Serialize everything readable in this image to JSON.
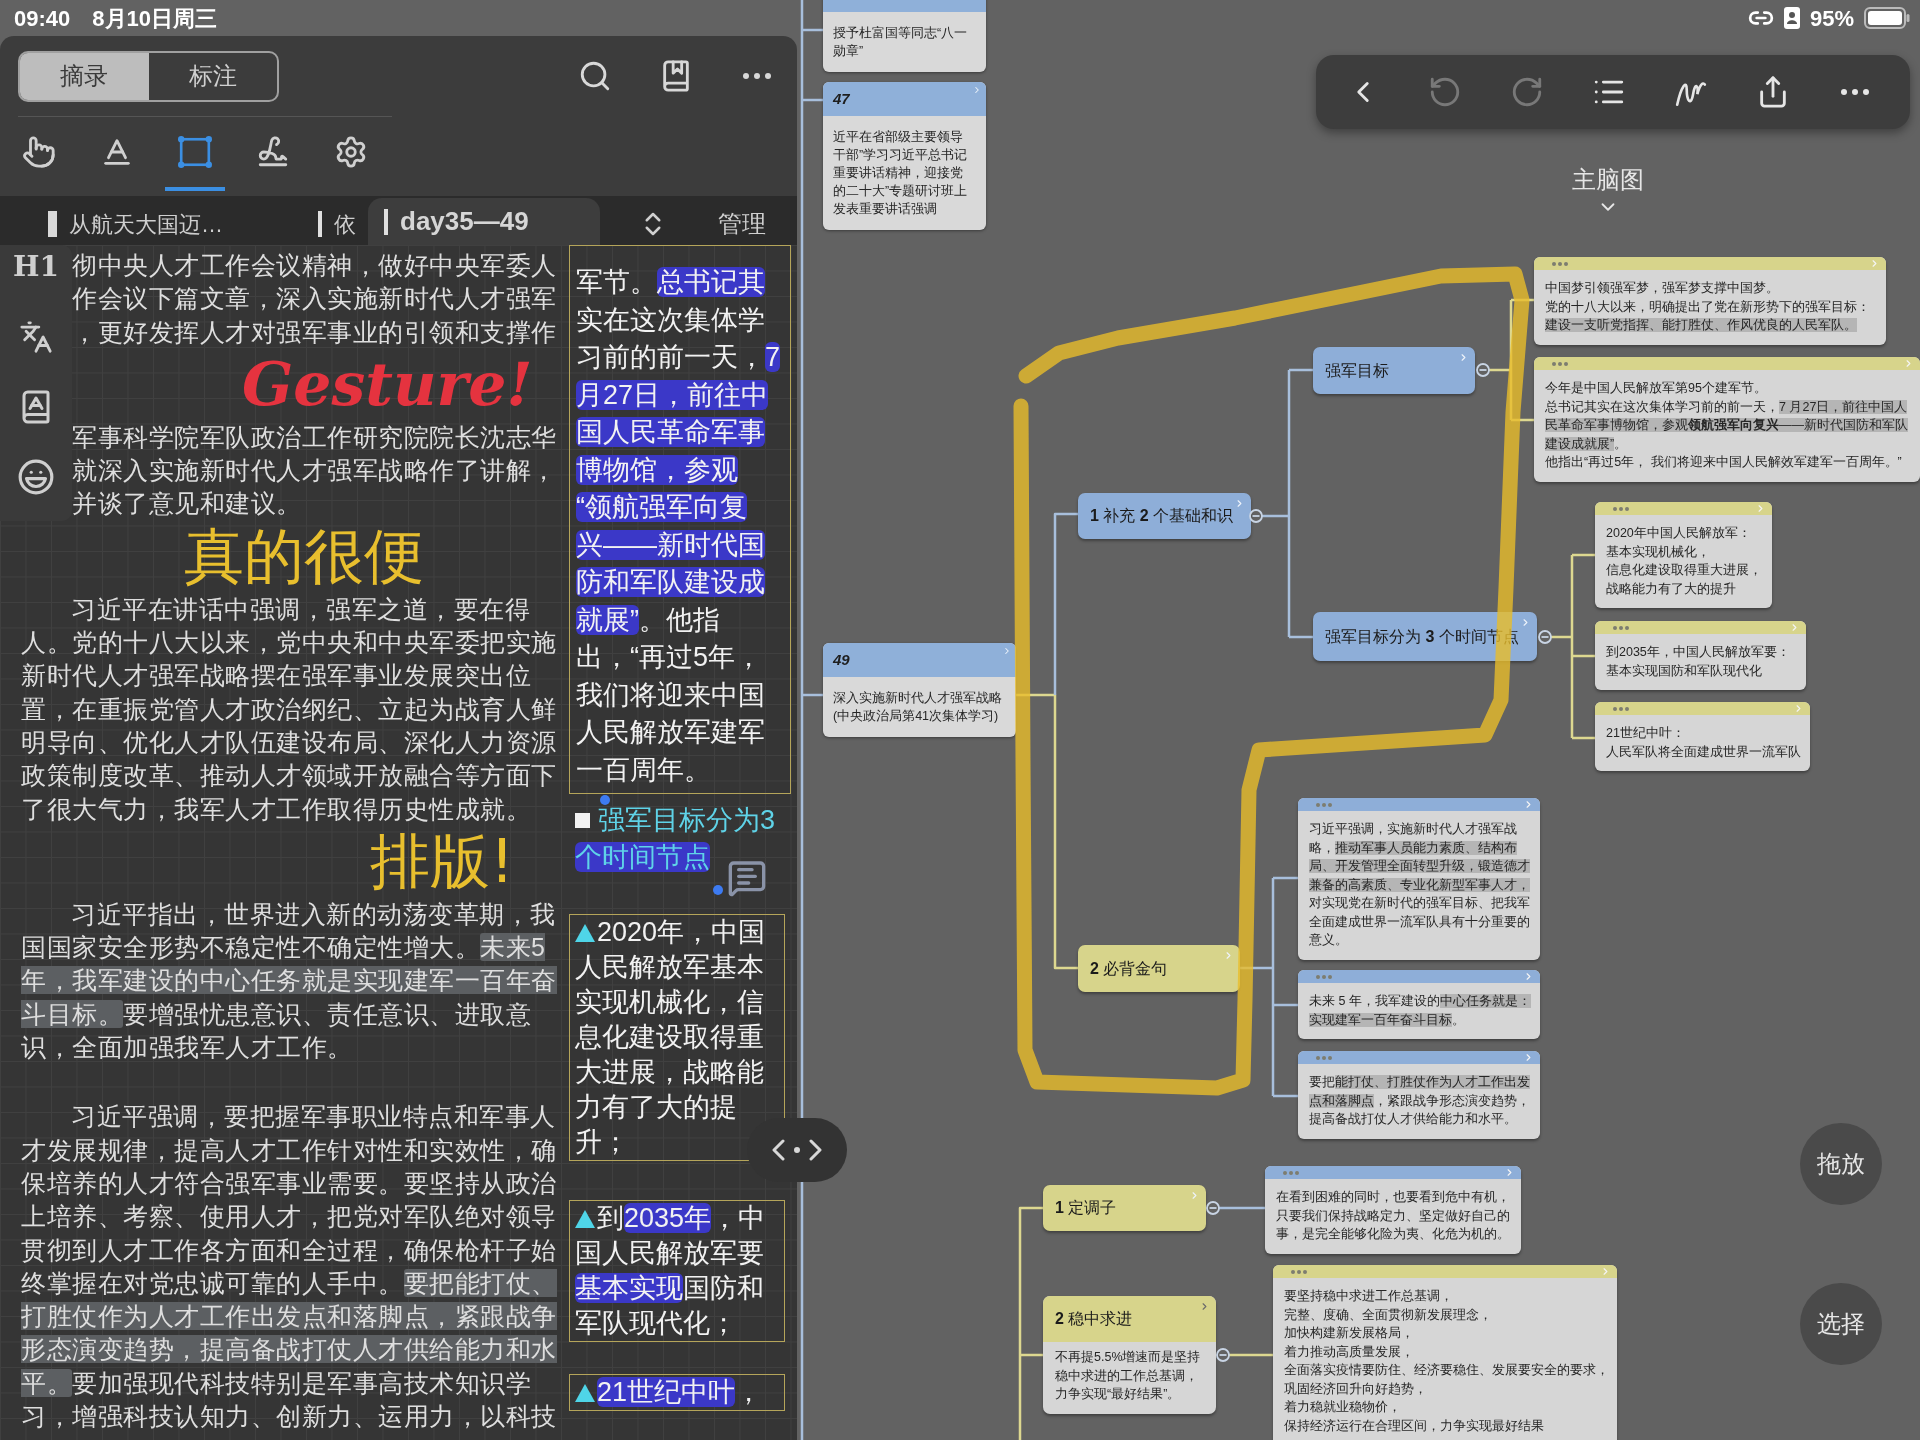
{
  "status_bar": {
    "time": "09:40",
    "date": "8月10日周三",
    "battery": "95%"
  },
  "excerpt_panel": {
    "mode_tabs": [
      {
        "label": "摘录",
        "selected": true
      },
      {
        "label": "标注",
        "selected": false
      }
    ],
    "tools": [
      {
        "selected": false
      },
      {
        "selected": false
      },
      {
        "selected": true
      },
      {
        "selected": false
      },
      {
        "selected": false
      }
    ],
    "doc_tabs": [
      {
        "label": "从航天大国迈…",
        "selected": false
      },
      {
        "label": "依",
        "selected": false
      },
      {
        "label": "day35—49",
        "selected": true
      }
    ],
    "manage_button": "管理",
    "side_toolbar": {
      "heading_button": "H1"
    },
    "paragraphs": [
      {
        "indented": false,
        "segments": [
          {
            "text": "彻中央人才工作会议精神，做好中央军委人作会议下篇文章，深入实施新时代人才强军，更好发挥人才对强军事业的引领和支撑作",
            "highlighted": false
          }
        ]
      },
      {
        "indented": false,
        "segments": [
          {
            "text": "军事科学院军队政治工作研究院院长沈志华就深入实施新时代人才强军战略作了讲解，并谈了意见和建议。",
            "highlighted": false
          }
        ]
      },
      {
        "indented": true,
        "segments": [
          {
            "text": "习近平在讲话中强调，强军之道，要在得人。党的十八大以来，党中央和中央军委把实施新时代人才强军战略摆在强军事业发展突出位置，在重振党管人才政治纲纪、立起为战育人鲜明导向、优化人才队伍建设布局、深化人力资源政策制度改革、推动人才领域开放融合等方面下了很大气力，我军人才工作取得历史性成就。",
            "highlighted": false
          }
        ]
      },
      {
        "indented": true,
        "segments": [
          {
            "text": "习近平指出，世界进入新的动荡变革期，我国国家安全形势不稳定性不确定性增大。",
            "highlighted": false
          },
          {
            "text": "未来5年，我军建设的中心任务就是实现建军一百年奋斗目标。",
            "highlighted": true
          },
          {
            "text": "要增强忧患意识、责任意识、进取意识，全面加强我军人才工作。",
            "highlighted": false
          }
        ]
      },
      {
        "indented": true,
        "segments": [
          {
            "text": "习近平强调，要把握军事职业特点和军事人才发展规律，提高人才工作针对性和实效性，确保培养的人才符合强军事业需要。要坚持从政治上培养、考察、使用人才，把党对军队绝对领导贯彻到人才工作各方面和全过程，确保枪杆子始终掌握在对党忠诚可靠的人手中。",
            "highlighted": false
          },
          {
            "text": "要把能打仗、打胜仗作为人才工作出发点和落脚点，紧跟战争形态演变趋势，提高备战打仗人才供给能力和水平。",
            "highlighted": true
          },
          {
            "text": "要加强现代科技特别是军事高技术知识学习，增强科技认知力、创新力、运用力，以科技",
            "highlighted": false
          }
        ]
      }
    ],
    "notes": [
      {
        "kind": "text",
        "lines": [
          [
            {
              "text": "军节。",
              "highlighted": false
            },
            {
              "text": "总书记其",
              "highlighted": true
            }
          ],
          [
            {
              "text": "实在这次集体学",
              "highlighted": false
            }
          ],
          [
            {
              "text": "习前的前一天，",
              "highlighted": false
            },
            {
              "text": "7",
              "highlighted": true
            }
          ],
          [
            {
              "text": "月27日，前往中",
              "highlighted": true
            }
          ],
          [
            {
              "text": "国人民革命军事",
              "highlighted": true
            }
          ],
          [
            {
              "text": "博物馆，参观",
              "highlighted": true
            }
          ],
          [
            {
              "text": "“领航强军向复",
              "highlighted": true
            }
          ],
          [
            {
              "text": "兴——新时代国",
              "highlighted": true
            }
          ],
          [
            {
              "text": "防和军队建设成",
              "highlighted": true
            }
          ],
          [
            {
              "text": "就展”",
              "highlighted": true
            },
            {
              "text": "。他指",
              "highlighted": false
            }
          ],
          [
            {
              "text": "出，“再过5年，",
              "highlighted": false
            }
          ],
          [
            {
              "text": "我们将迎来中国",
              "highlighted": false
            }
          ],
          [
            {
              "text": "人民解放军建军",
              "highlighted": false
            }
          ],
          [
            {
              "text": "一百周年。",
              "highlighted": false
            }
          ]
        ]
      },
      {
        "kind": "heading",
        "lines": [
          [
            {
              "text": "强军目标分为3",
              "highlighted": false
            }
          ],
          [
            {
              "text": "个时间节点",
              "highlighted": true
            }
          ]
        ]
      },
      {
        "kind": "bullet",
        "lines": [
          [
            {
              "text": "2020年，中国",
              "highlighted": false
            }
          ],
          [
            {
              "text": "人民解放军基本",
              "highlighted": false
            }
          ],
          [
            {
              "text": "实现机械化，信",
              "highlighted": false
            }
          ],
          [
            {
              "text": "息化建设取得重",
              "highlighted": false
            }
          ],
          [
            {
              "text": "大进展，战略能",
              "highlighted": false
            }
          ],
          [
            {
              "text": "力有了大的提",
              "highlighted": false
            }
          ],
          [
            {
              "text": "升；",
              "highlighted": false
            }
          ]
        ]
      },
      {
        "kind": "bullet",
        "lines": [
          [
            {
              "text": "到",
              "highlighted": false
            },
            {
              "text": "2035年",
              "highlighted": true
            },
            {
              "text": "，中",
              "highlighted": false
            }
          ],
          [
            {
              "text": "国人民解放军要",
              "highlighted": false
            }
          ],
          [
            {
              "text": "基本实现",
              "highlighted": true
            },
            {
              "text": "国防和",
              "highlighted": false
            }
          ],
          [
            {
              "text": "军队现代化；",
              "highlighted": false
            }
          ]
        ]
      },
      {
        "kind": "bullet",
        "lines": [
          [
            {
              "text": "21世纪中叶",
              "highlighted": true
            },
            {
              "text": "，",
              "highlighted": false
            }
          ]
        ]
      }
    ]
  },
  "annotations": [
    {
      "text": "Gesture!",
      "color": "#e5333f"
    },
    {
      "text": "真的很便",
      "color": "#e8bf2e"
    },
    {
      "text": "排版!",
      "color": "#e8bf2e"
    }
  ],
  "mindmap": {
    "title": "主脑图",
    "toolbar": [
      {
        "disabled": false
      },
      {
        "disabled": true
      },
      {
        "disabled": true
      },
      {
        "disabled": false
      },
      {
        "disabled": false
      },
      {
        "disabled": false
      },
      {
        "disabled": false
      }
    ],
    "outline_cards": [
      {
        "lines": [
          "授予杜富国等同志“八一",
          "勋章”"
        ]
      },
      {
        "number": "47",
        "lines": [
          "近平在省部级主要领导",
          "干部”学习习近平总书记",
          "重要讲话精神，迎接党",
          "的二十大”专题研讨班上",
          "发表重要讲话强调"
        ]
      },
      {
        "number": "49",
        "lines": [
          "深入实施新时代人才强军战略",
          "(中央政治局第41次集体学习)"
        ]
      }
    ],
    "nodes": [
      {
        "label": "**1** 补充 **2** 个基础和识",
        "color": "#8eaed8"
      },
      {
        "label": "强军目标",
        "color": "#8eaed8"
      },
      {
        "label": "强军目标分为 **3** 个时间节点",
        "color": "#8eaed8"
      },
      {
        "label": "**2** 必背金句",
        "color": "#d7d48b"
      },
      {
        "label": "**1** 定调子",
        "color": "#d7d48b"
      },
      {
        "label": "**2** 稳中求进",
        "color": "#d7d48b",
        "body": [
          "不再提5.5%增速而是坚持",
          "稳中求进的工作总基调，",
          "力争实现“最好结果”。"
        ]
      }
    ],
    "cards": [
      {
        "color": "#d7d48b",
        "lines": [
          [
            {
              "text": "中国梦引领强军梦，强军梦支撑中国梦。",
              "highlighted": false
            }
          ],
          [
            {
              "text": "党的十八大以来，明确提出了党在新形势下的强军目标：",
              "highlighted": false
            }
          ],
          [
            {
              "text": "建设一支听党指挥、能打胜仗、作风优良的人民军队。",
              "highlighted": true
            }
          ]
        ]
      },
      {
        "color": "#d7d48b",
        "lines": [
          [
            {
              "text": "今年是中国人民解放军第95个建军节。",
              "highlighted": false
            }
          ],
          [
            {
              "text": "总书记其实在这次集体学习前的前一天，",
              "highlighted": false
            },
            {
              "text": "7 月27日，前往中国人",
              "highlighted": true
            }
          ],
          [
            {
              "text": "民革命军事博物馆，参观**领航强军向复兴**——新时代国防和军队",
              "highlighted": true
            }
          ],
          [
            {
              "text": "建设成就展”",
              "highlighted": true
            },
            {
              "text": "。",
              "highlighted": false
            }
          ],
          [
            {
              "text": "他指出“再过5年， 我们将迎来中国人民解效军建军一百周年。”",
              "highlighted": false
            }
          ]
        ]
      },
      {
        "color": "#d7d48b",
        "lines": [
          [
            {
              "text": "2020年中国人民解放军：",
              "highlighted": false
            }
          ],
          [
            {
              "text": "基本实现机械化，",
              "highlighted": false
            }
          ],
          [
            {
              "text": "信息化建设取得重大进展，",
              "highlighted": false
            }
          ],
          [
            {
              "text": "战略能力有了大的提升",
              "highlighted": false
            }
          ]
        ]
      },
      {
        "color": "#d7d48b",
        "lines": [
          [
            {
              "text": "到2035年，中国人民解放军要：",
              "highlighted": false
            }
          ],
          [
            {
              "text": "基本实现国防和军队现代化",
              "highlighted": false
            }
          ]
        ]
      },
      {
        "color": "#d7d48b",
        "lines": [
          [
            {
              "text": "21世纪中叶：",
              "highlighted": false
            }
          ],
          [
            {
              "text": "人民军队将全面建成世界一流军队",
              "highlighted": false
            }
          ]
        ]
      },
      {
        "color": "#8eaed8",
        "lines": [
          [
            {
              "text": "习近平强调，实施新时代人才强军战",
              "highlighted": false
            }
          ],
          [
            {
              "text": "略，",
              "highlighted": false
            },
            {
              "text": "推动军事人员能力素质、结构布",
              "highlighted": true
            }
          ],
          [
            {
              "text": "局、开发管理全面转型升级，锻造德才",
              "highlighted": true
            }
          ],
          [
            {
              "text": "兼备的高素质、专业化新型军事人才，",
              "highlighted": true
            }
          ],
          [
            {
              "text": "对实现党在新时代的强军目标、把我军",
              "highlighted": false
            }
          ],
          [
            {
              "text": "全面建成世界一流军队具有十分重要的",
              "highlighted": false
            }
          ],
          [
            {
              "text": "意义。",
              "highlighted": false
            }
          ]
        ]
      },
      {
        "color": "#8eaed8",
        "lines": [
          [
            {
              "text": "未来 5 年，我军建设的",
              "highlighted": false
            },
            {
              "text": "中心任务就是：",
              "highlighted": true
            }
          ],
          [
            {
              "text": "实现建军一百年奋斗目标",
              "highlighted": true
            },
            {
              "text": "。",
              "highlighted": false
            }
          ]
        ]
      },
      {
        "color": "#8eaed8",
        "lines": [
          [
            {
              "text": "要把",
              "highlighted": false
            },
            {
              "text": "能打仗、打胜仗作为人才工作出发",
              "highlighted": true
            }
          ],
          [
            {
              "text": "点和落脚点",
              "highlighted": true
            },
            {
              "text": "，紧跟战争形态演变趋势，",
              "highlighted": false
            }
          ],
          [
            {
              "text": "提高备战打仗人才供给能力和水平。",
              "highlighted": false
            }
          ]
        ]
      },
      {
        "color": "#8eaed8",
        "lines": [
          [
            {
              "text": "在看到困难的同时，也要看到危中有机，",
              "highlighted": false
            }
          ],
          [
            {
              "text": "只要我们保持战略定力、坚定做好自己的",
              "highlighted": false
            }
          ],
          [
            {
              "text": "事，是完全能够化险为夷、化危为机的。",
              "highlighted": false
            }
          ]
        ]
      },
      {
        "color": "#d7d48b",
        "lines": [
          [
            {
              "text": "要坚持稳中求进工作总基调，",
              "highlighted": false
            }
          ],
          [
            {
              "text": "完整、度确、全面贯彻新发展理念，",
              "highlighted": false
            }
          ],
          [
            {
              "text": "加快构建新发展格局，",
              "highlighted": false
            }
          ],
          [
            {
              "text": "着力推动高质量发展，",
              "highlighted": false
            }
          ],
          [
            {
              "text": "全面落实疫情要防住、经济要稳住、发展要安全的要求，",
              "highlighted": false
            }
          ],
          [
            {
              "text": "巩固经济回升向好趋势，",
              "highlighted": false
            }
          ],
          [
            {
              "text": "着力稳就业稳物价，",
              "highlighted": false
            }
          ],
          [
            {
              "text": "保持经济运行在合理区间，力争实现最好结果",
              "highlighted": false
            }
          ]
        ]
      }
    ],
    "floating_buttons": [
      "拖放",
      "选择"
    ]
  }
}
